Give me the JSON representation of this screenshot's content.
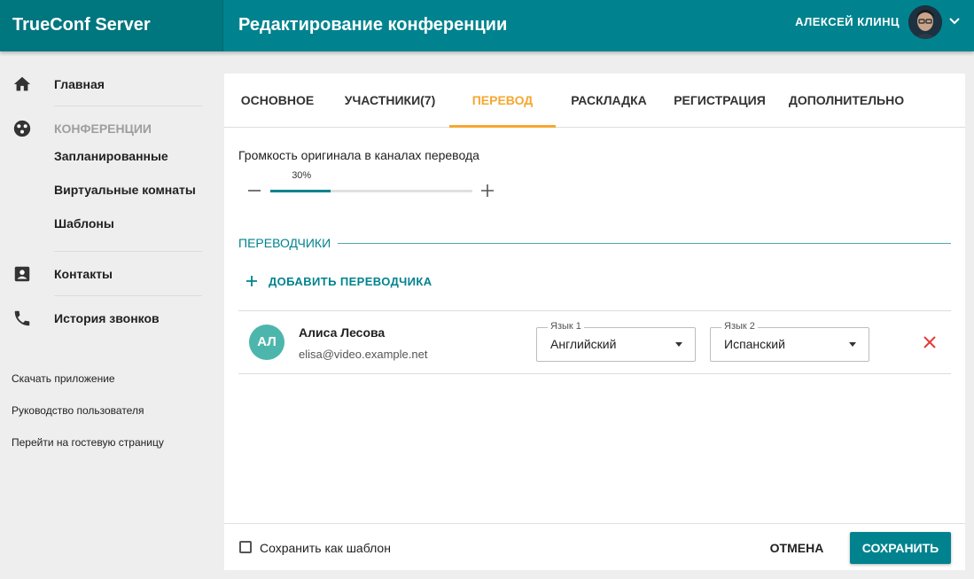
{
  "app": {
    "brand": "TrueConf Server",
    "page_title": "Редактирование конференции"
  },
  "user": {
    "name": "АЛЕКСЕЙ КЛИНЦ",
    "avatar_icon": "user-photo",
    "menu_icon": "chevron-down-icon"
  },
  "sidebar": {
    "home": {
      "label": "Главная",
      "icon": "home-icon"
    },
    "conferences": {
      "label": "КОНФЕРЕНЦИИ",
      "icon": "conferences-icon",
      "items": [
        {
          "label": "Запланированные"
        },
        {
          "label": "Виртуальные комнаты"
        },
        {
          "label": "Шаблоны"
        }
      ]
    },
    "contacts": {
      "label": "Контакты",
      "icon": "contacts-icon"
    },
    "call_history": {
      "label": "История звонков",
      "icon": "phone-icon"
    },
    "links": [
      {
        "label": "Скачать приложение"
      },
      {
        "label": "Руководство пользователя"
      },
      {
        "label": "Перейти на гостевую страницу"
      }
    ]
  },
  "tabs": [
    {
      "label": "ОСНОВНОЕ",
      "active": false
    },
    {
      "label": "УЧАСТНИКИ(7)",
      "active": false
    },
    {
      "label": "ПЕРЕВОД",
      "active": true
    },
    {
      "label": "РАСКЛАДКА",
      "active": false
    },
    {
      "label": "РЕГИСТРАЦИЯ",
      "active": false
    },
    {
      "label": "ДОПОЛНИТЕЛЬНО",
      "active": false
    }
  ],
  "volume": {
    "label": "Громкость оригинала в каналах перевода",
    "value": 30,
    "value_text": "30%"
  },
  "translators": {
    "title": "ПЕРЕВОДЧИКИ",
    "add_label": "ДОБАВИТЬ ПЕРЕВОДЧИКА",
    "list": [
      {
        "initials": "АЛ",
        "name": "Алиса Лесова",
        "email": "elisa@video.example.net",
        "lang1_label": "Язык 1",
        "lang1_value": "Английский",
        "lang2_label": "Язык 2",
        "lang2_value": "Испанский"
      }
    ]
  },
  "footer": {
    "save_as_template": "Сохранить как шаблон",
    "template_checked": false,
    "cancel": "ОТМЕНА",
    "save": "СОХРАНИТЬ"
  },
  "colors": {
    "primary": "#00838f",
    "brand_bg": "#00767f",
    "active_tab": "#f6a730",
    "danger": "#e53935",
    "avatar_bg": "#4db6ac"
  }
}
